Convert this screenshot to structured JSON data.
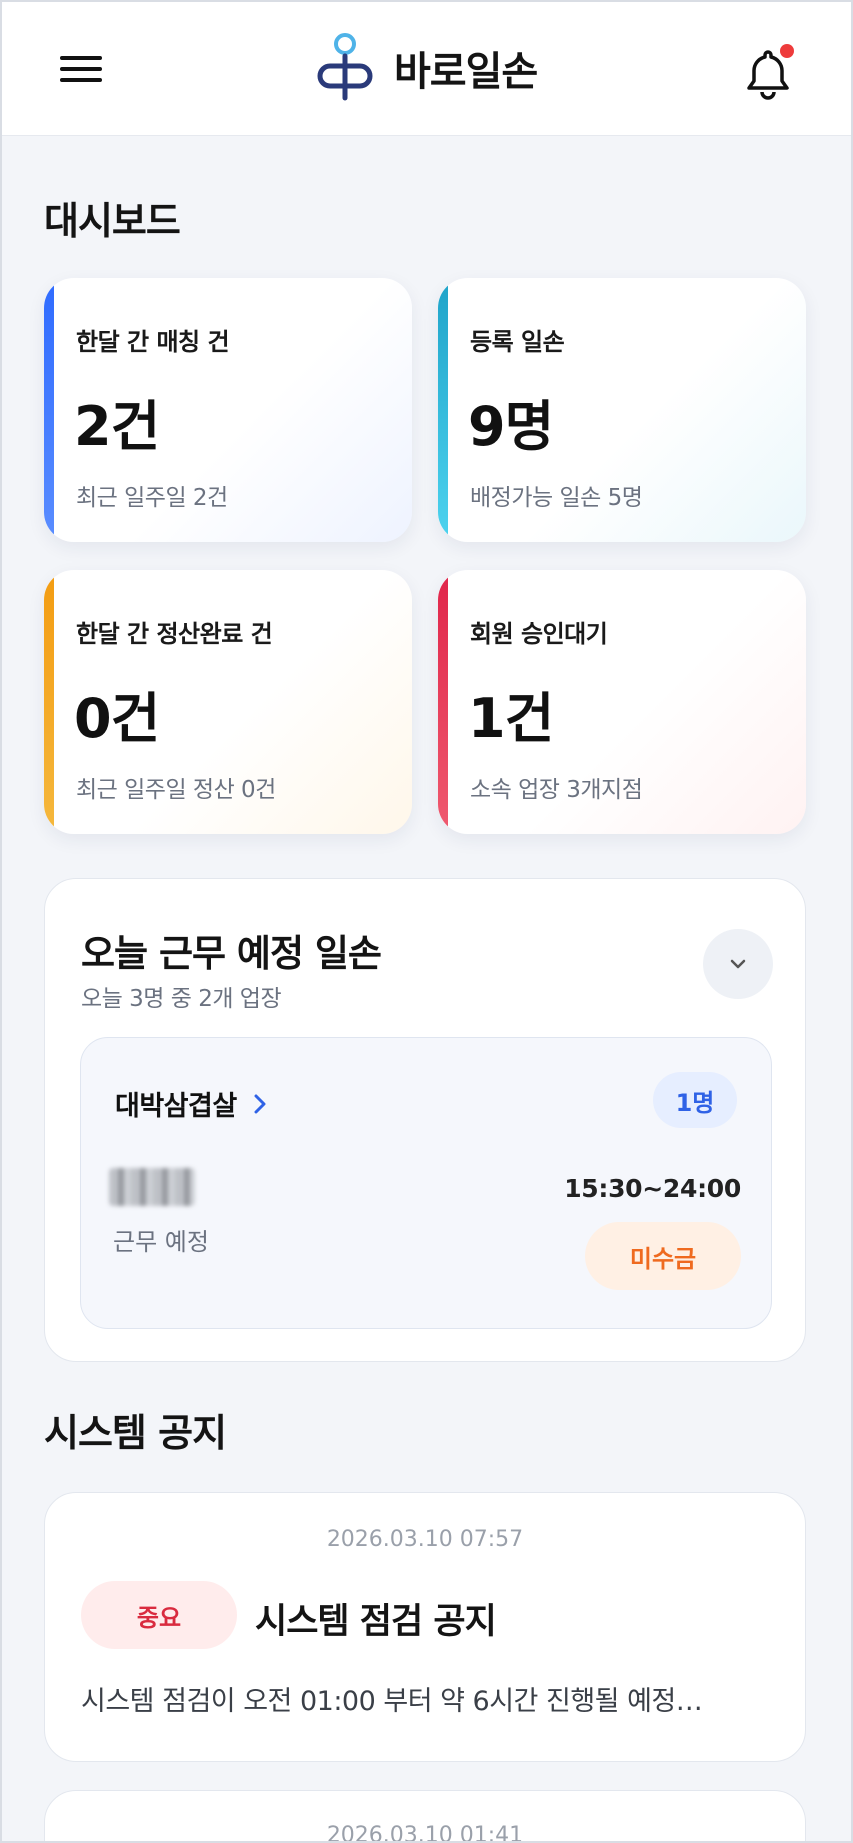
{
  "header": {
    "brand_name": "바로일손",
    "notification_unread": true
  },
  "dashboard": {
    "title": "대시보드",
    "cards": [
      {
        "label": "한달 간 매칭 건",
        "value": "2건",
        "sub": "최근 일주일 2건",
        "accent": "#2f6bff"
      },
      {
        "label": "등록 일손",
        "value": "9명",
        "sub": "배정가능 일손 5명",
        "accent": "#1fa3c9"
      },
      {
        "label": "한달 간 정산완료 건",
        "value": "0건",
        "sub": "최근 일주일 정산 0건",
        "accent": "#f39c12"
      },
      {
        "label": "회원 승인대기",
        "value": "1건",
        "sub": "소속 업장 3개지점",
        "accent": "#e0254a"
      }
    ]
  },
  "today": {
    "title": "오늘 근무 예정 일손",
    "subtitle": "오늘 3명 중 2개 업장",
    "sites": [
      {
        "name": "대박삼겹살",
        "count": "1명",
        "worker_status": "근무 예정",
        "time": "15:30~24:00",
        "payment_status": "미수금"
      }
    ]
  },
  "notices": {
    "title": "시스템 공지",
    "items": [
      {
        "date": "2026.03.10 07:57",
        "badge": "중요",
        "title": "시스템 점검 공지",
        "body": "시스템 점검이 오전 01:00 부터 약 6시간 진행될 예정…"
      },
      {
        "date": "2026.03.10 01:41"
      }
    ]
  },
  "colors": {
    "page_bg": "#f3f5f9",
    "primary": "#2f62e6",
    "unpaid": "#ef6a1f",
    "important": "#d92b3f",
    "notification_dot": "#ee3b3b"
  }
}
